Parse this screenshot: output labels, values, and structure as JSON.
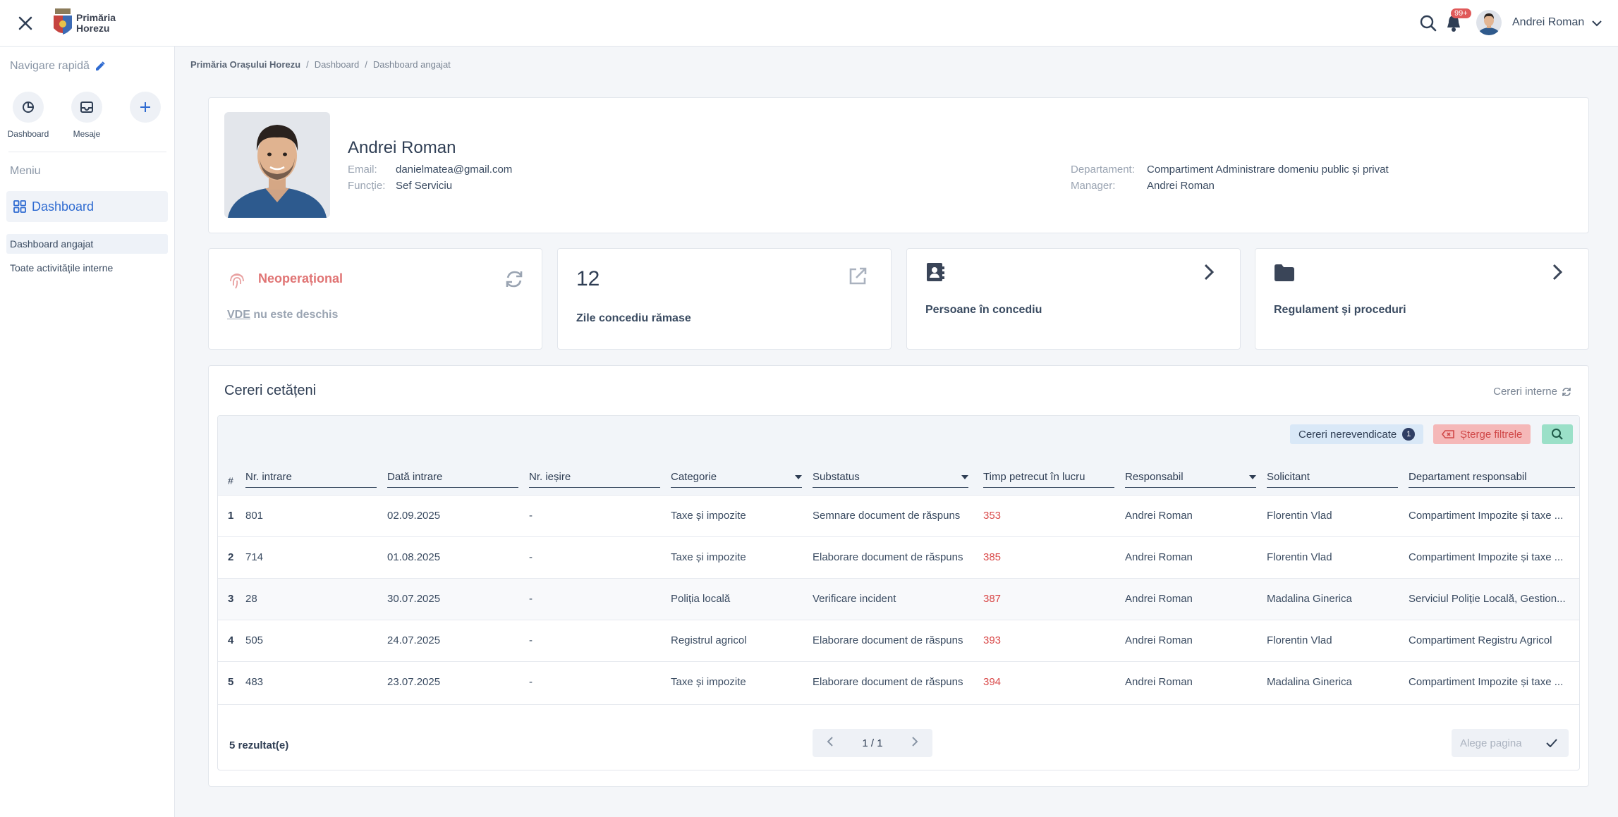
{
  "topbar": {
    "logo_line1": "Primăria",
    "logo_line2": "Horezu",
    "notif_count": "99+",
    "user_name": "Andrei Roman"
  },
  "sidebar": {
    "nav_title": "Navigare rapidă",
    "quick": [
      {
        "label": "Dashboard",
        "icon": "pie-chart-icon"
      },
      {
        "label": "Mesaje",
        "icon": "inbox-icon"
      },
      {
        "label": "",
        "icon": "plus-icon"
      }
    ],
    "menu_title": "Meniu",
    "menu_item": "Dashboard",
    "sub_items": [
      "Dashboard angajat",
      "Toate activitățile interne"
    ]
  },
  "breadcrumb": [
    "Primăria Orașului Horezu",
    "Dashboard",
    "Dashboard angajat"
  ],
  "profile": {
    "name": "Andrei Roman",
    "email_label": "Email:",
    "email": "danielmatea@gmail.com",
    "function_label": "Funcție:",
    "function": "Sef Serviciu",
    "department_label": "Departament:",
    "department": "Compartiment Administrare domeniu public și privat",
    "manager_label": "Manager:",
    "manager": "Andrei Roman"
  },
  "cards": {
    "status_title": "Neoperațional",
    "status_vde": "VDE",
    "status_rest": " nu este deschis",
    "leave_days": "12",
    "leave_label": "Zile concediu rămase",
    "people_label": "Persoane în concediu",
    "rules_label": "Regulament și proceduri"
  },
  "table": {
    "title": "Cereri cetățeni",
    "intern_link": "Cereri interne",
    "btn_unclaimed": "Cereri nerevendicate",
    "unclaimed_count": "1",
    "btn_clear": "Șterge filtrele",
    "hash": "#",
    "columns": [
      "Nr. intrare",
      "Dată intrare",
      "Nr. ieșire",
      "Categorie",
      "Substatus",
      "Timp petrecut în lucru",
      "Responsabil",
      "Solicitant",
      "Departament responsabil"
    ],
    "rows": [
      [
        "1",
        "801",
        "02.09.2025",
        "-",
        "Taxe și impozite",
        "Semnare document de răspuns",
        "353",
        "Andrei Roman",
        "Florentin Vlad",
        "Compartiment Impozite și taxe ..."
      ],
      [
        "2",
        "714",
        "01.08.2025",
        "-",
        "Taxe și impozite",
        "Elaborare document de răspuns",
        "385",
        "Andrei Roman",
        "Florentin Vlad",
        "Compartiment Impozite și taxe ..."
      ],
      [
        "3",
        "28",
        "30.07.2025",
        "-",
        "Poliția locală",
        "Verificare incident",
        "387",
        "Andrei Roman",
        "Madalina Ginerica",
        "Serviciul Poliție Locală, Gestion..."
      ],
      [
        "4",
        "505",
        "24.07.2025",
        "-",
        "Registrul agricol",
        "Elaborare document de răspuns",
        "393",
        "Andrei Roman",
        "Florentin Vlad",
        "Compartiment Registru Agricol"
      ],
      [
        "5",
        "483",
        "23.07.2025",
        "-",
        "Taxe și impozite",
        "Elaborare document de răspuns",
        "394",
        "Andrei Roman",
        "Madalina Ginerica",
        "Compartiment Impozite și taxe ..."
      ]
    ],
    "results": "5 rezultat(e)",
    "page": "1 / 1",
    "page_select_placeholder": "Alege pagina"
  },
  "colors": {
    "accent": "#2f6bd1",
    "danger": "#e07474",
    "success": "#9be0c8"
  }
}
